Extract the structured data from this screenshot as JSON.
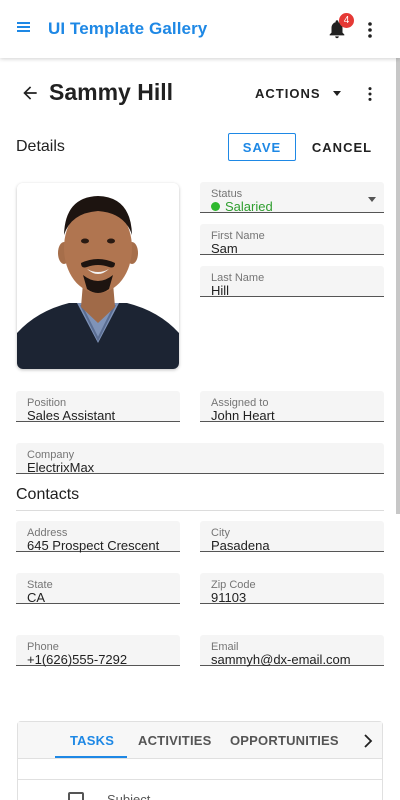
{
  "app": {
    "title": "UI Template Gallery",
    "notification_count": "4",
    "accent_color": "#1e88e5",
    "badge_color": "#e53935"
  },
  "header": {
    "contact_name": "Sammy Hill",
    "actions_label": "ACTIONS"
  },
  "details": {
    "section_title": "Details",
    "save_label": "SAVE",
    "cancel_label": "CANCEL",
    "status": {
      "label": "Status",
      "value": "Salaried",
      "color": "#2eb82e"
    },
    "first_name": {
      "label": "First Name",
      "value": "Sam"
    },
    "last_name": {
      "label": "Last Name",
      "value": "Hill"
    },
    "position": {
      "label": "Position",
      "value": "Sales Assistant"
    },
    "assigned_to": {
      "label": "Assigned to",
      "value": "John Heart"
    },
    "company": {
      "label": "Company",
      "value": "ElectrixMax"
    }
  },
  "contacts": {
    "section_title": "Contacts",
    "address": {
      "label": "Address",
      "value": "645 Prospect Crescent"
    },
    "city": {
      "label": "City",
      "value": "Pasadena"
    },
    "state": {
      "label": "State",
      "value": "CA"
    },
    "zip": {
      "label": "Zip Code",
      "value": "91103"
    },
    "phone": {
      "label": "Phone",
      "value": "+1(626)555-7292"
    },
    "email": {
      "label": "Email",
      "value": "sammyh@dx-email.com"
    }
  },
  "tabs": {
    "items": [
      {
        "label": "TASKS",
        "active": true
      },
      {
        "label": "ACTIVITIES",
        "active": false
      },
      {
        "label": "OPPORTUNITIES",
        "active": false
      }
    ],
    "grid_columns": [
      "Subject"
    ]
  },
  "icons": {
    "menu": "menu-icon",
    "bell": "bell-icon",
    "more": "more-vert-icon",
    "back": "arrow-back-icon",
    "dropdown": "caret-down-icon",
    "next": "chevron-right-icon"
  }
}
